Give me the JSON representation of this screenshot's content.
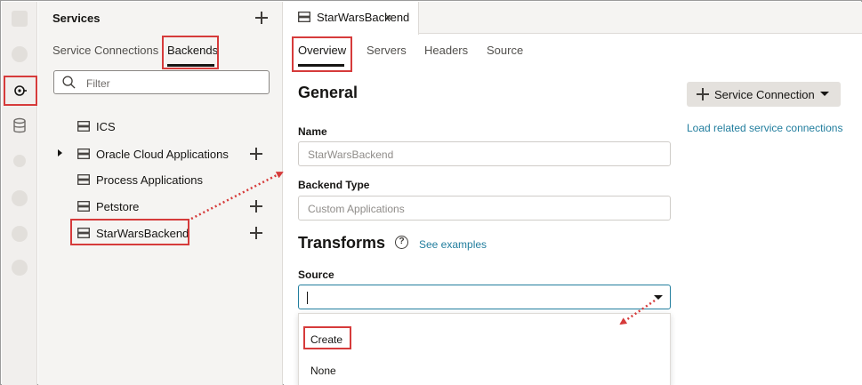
{
  "services": {
    "title": "Services",
    "tabs": [
      {
        "label": "Service Connections"
      },
      {
        "label": "Backends"
      }
    ],
    "filter_placeholder": "Filter",
    "items": [
      {
        "label": "ICS"
      },
      {
        "label": "Oracle Cloud Applications"
      },
      {
        "label": "Process Applications"
      },
      {
        "label": "Petstore"
      },
      {
        "label": "StarWarsBackend"
      }
    ]
  },
  "editor": {
    "tab_title": "StarWarsBackend",
    "close_symbol": "×",
    "sub_tabs": [
      {
        "label": "Overview"
      },
      {
        "label": "Servers"
      },
      {
        "label": "Headers"
      },
      {
        "label": "Source"
      }
    ],
    "general_heading": "General",
    "name_label": "Name",
    "name_value": "StarWarsBackend",
    "backend_type_label": "Backend Type",
    "backend_type_value": "Custom Applications",
    "transforms_heading": "Transforms",
    "help_symbol": "?",
    "see_examples": "See examples",
    "source_label": "Source",
    "source_options": [
      {
        "label": "Create"
      },
      {
        "label": "None"
      }
    ],
    "service_connection_button": "Service Connection",
    "load_related": "Load related service connections"
  },
  "colors": {
    "highlight": "#d63b3b",
    "link": "#227e9e"
  }
}
